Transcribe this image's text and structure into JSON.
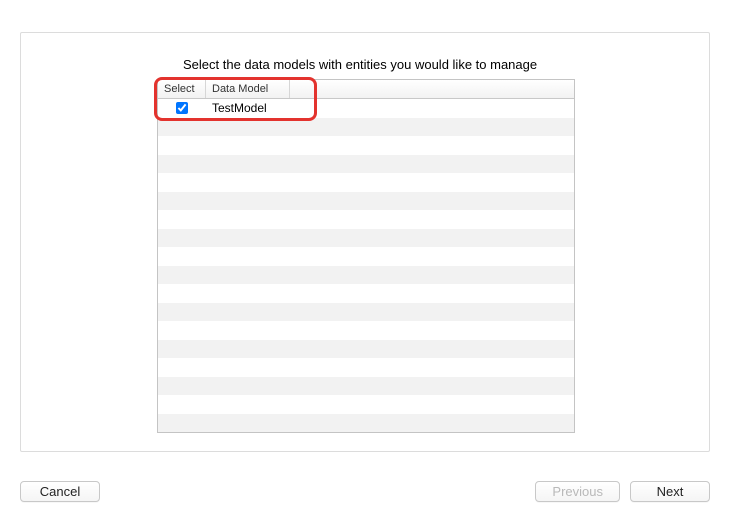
{
  "instruction": "Select the data models with entities you would like to manage",
  "table": {
    "headers": {
      "select": "Select",
      "data_model": "Data Model"
    },
    "rows": [
      {
        "checked": true,
        "model": "TestModel"
      }
    ],
    "blank_row_count": 17
  },
  "buttons": {
    "cancel": "Cancel",
    "previous": "Previous",
    "next": "Next"
  }
}
